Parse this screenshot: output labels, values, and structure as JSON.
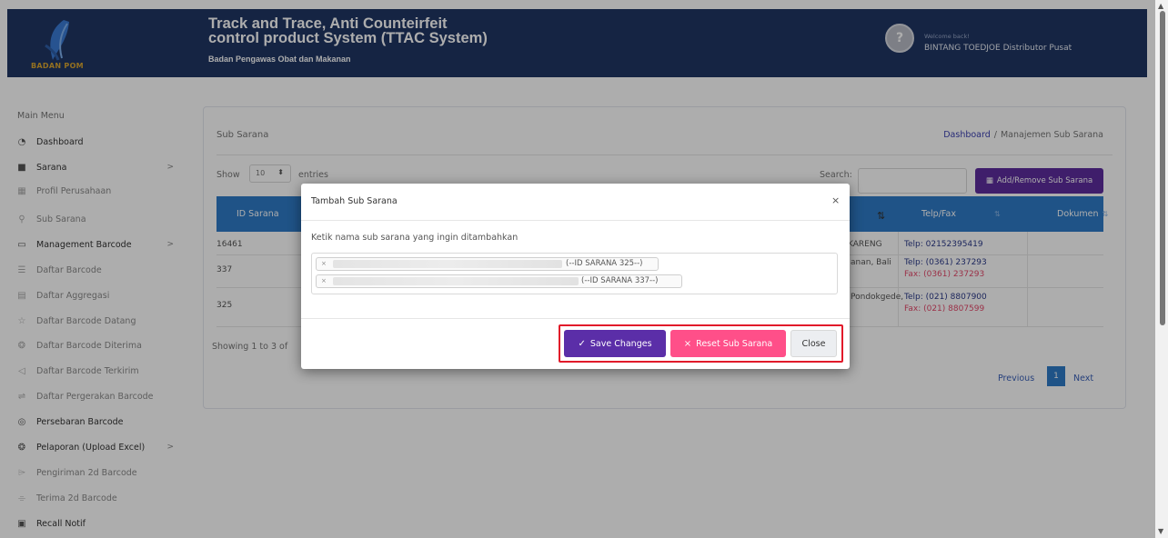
{
  "header": {
    "logo_text": "BADAN POM",
    "title_line1": "Track and Trace, Anti Counteirfeit",
    "title_line2": "control product System (TTAC System)",
    "subtitle": "Badan Pengawas Obat dan Makanan",
    "welcome": "Welcome back!",
    "user_name": "BINTANG TOEDJOE Distributor Pusat",
    "avatar_glyph": "?"
  },
  "sidebar": {
    "menu_title": "Main Menu",
    "items": [
      {
        "label": "Dashboard",
        "icon": "dashboard-icon",
        "glyph": "◔"
      },
      {
        "label": "Sarana",
        "icon": "sarana-icon",
        "glyph": "■",
        "chevron": ">"
      },
      {
        "label": "Profil Perusahaan",
        "icon": "building-icon",
        "glyph": "▦"
      },
      {
        "label": "Sub Sarana",
        "icon": "sitemap-icon",
        "glyph": "⚲"
      },
      {
        "label": "Management Barcode",
        "icon": "folder-icon",
        "glyph": "▭",
        "chevron": ">"
      },
      {
        "label": "Daftar Barcode",
        "icon": "list-icon",
        "glyph": "☰"
      },
      {
        "label": "Daftar Aggregasi",
        "icon": "aggregation-icon",
        "glyph": "▤"
      },
      {
        "label": "Daftar Barcode Datang",
        "icon": "star-icon",
        "glyph": "☆"
      },
      {
        "label": "Daftar Barcode Diterima",
        "icon": "received-icon",
        "glyph": "❂"
      },
      {
        "label": "Daftar Barcode Terkirim",
        "icon": "send-icon",
        "glyph": "◁"
      },
      {
        "label": "Daftar Pergerakan Barcode",
        "icon": "movement-icon",
        "glyph": "⇌"
      },
      {
        "label": "Persebaran Barcode",
        "icon": "location-icon",
        "glyph": "◎"
      },
      {
        "label": "Pelaporan (Upload Excel)",
        "icon": "report-icon",
        "glyph": "❂",
        "chevron": ">"
      },
      {
        "label": "Pengiriman 2d Barcode",
        "icon": "shipping-icon",
        "glyph": "⌲"
      },
      {
        "label": "Terima 2d Barcode",
        "icon": "receive-icon",
        "glyph": "⌯"
      },
      {
        "label": "Recall Notif",
        "icon": "monitor-icon",
        "glyph": "▣"
      }
    ]
  },
  "page": {
    "title": "Sub Sarana",
    "breadcrumb_link": "Dashboard",
    "breadcrumb_sep": "/",
    "breadcrumb_current": "Manajemen Sub Sarana",
    "show_label": "Show",
    "show_value": "10",
    "show_caret": "⬍",
    "entries_label": "entries",
    "search_label": "Search:",
    "add_button": "Add/Remove Sub Sarana",
    "add_glyph": "▦",
    "showing_text": "Showing 1 to 3 of",
    "pagination": {
      "previous": "Previous",
      "page": "1",
      "next": "Next"
    }
  },
  "table": {
    "headers": {
      "id": "ID Sarana",
      "telp": "Telp/Fax",
      "dokumen": "Dokumen"
    },
    "sort_glyph": "⇅",
    "rows": [
      {
        "id": "16461",
        "addr": "KARENG",
        "telp": "Telp: 02152395419",
        "fax": ""
      },
      {
        "id": "337",
        "addr": "anan, Bali",
        "telp": "Telp: (0361) 237293",
        "fax": "Fax: (0361) 237293"
      },
      {
        "id": "325",
        "addr": "Pondokgede,",
        "telp": "Telp: (021) 8807900",
        "fax": "Fax: (021) 8807599"
      }
    ]
  },
  "modal": {
    "title": "Tambah Sub Sarana",
    "close_glyph": "×",
    "label": "Ketik nama sub sarana yang ingin ditambahkan",
    "tags": [
      {
        "remove": "×",
        "text": "(--ID SARANA 325--)"
      },
      {
        "remove": "×",
        "text": "(--ID SARANA 337--)"
      }
    ],
    "save_label": "Save Changes",
    "save_glyph": "✓",
    "reset_label": "Reset Sub Sarana",
    "reset_glyph": "×",
    "close_label": "Close"
  },
  "scrollbar": {
    "up": "▲",
    "down": "▼"
  },
  "colors": {
    "header_bg": "#1f3564",
    "accent_purple": "#5b2ea8",
    "reset_pink": "#ff4f89",
    "table_head_blue": "#2e7bc8",
    "highlight_red": "#e11a2a"
  }
}
